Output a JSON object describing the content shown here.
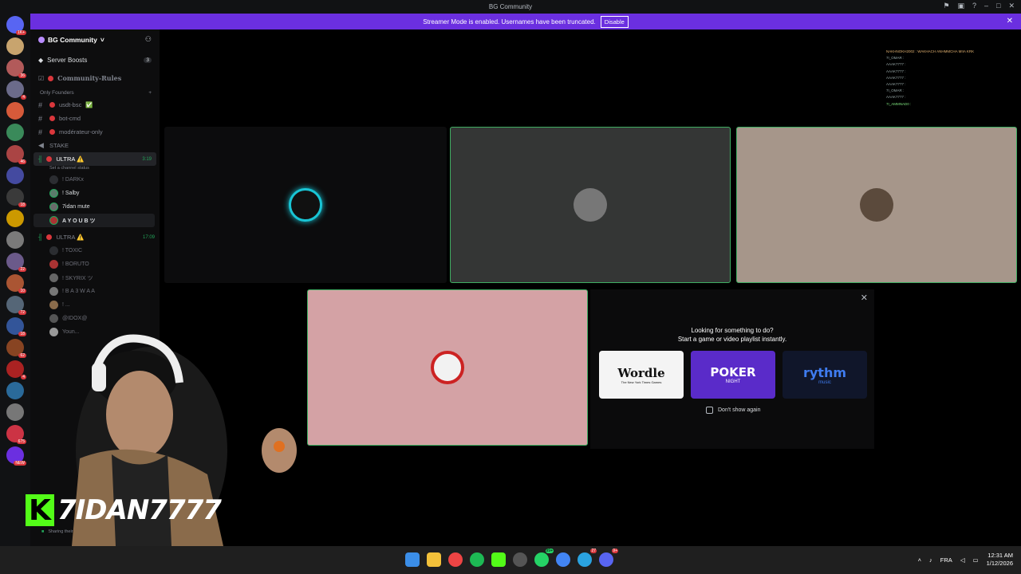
{
  "window": {
    "title": "BG Community"
  },
  "banner": {
    "text": "Streamer Mode is enabled. Usernames have been truncated.",
    "button": "Disable"
  },
  "server_badges": [
    "1K+",
    "",
    "36",
    "4",
    "",
    "",
    "46",
    "",
    "18",
    "",
    "",
    "22",
    "10",
    "72",
    "18",
    "62",
    "4",
    "",
    "",
    "675",
    "NEW"
  ],
  "sidebar": {
    "guild_name": "BG Community",
    "boost_label": "Server Boosts",
    "boost_count": "3",
    "rules_channel": "Community-Rules",
    "category_name": "Only Founders",
    "channels": [
      {
        "name": "usdt-bsc",
        "suffix": "✅"
      },
      {
        "name": "bot-cmd",
        "suffix": ""
      },
      {
        "name": "modérateur-only",
        "suffix": ""
      }
    ],
    "stake_channel": "STAKE",
    "voice1": {
      "name": "ULTRA ⚠️",
      "time": "3:19",
      "status": "Set a channel status"
    },
    "voice1_members": [
      "! DARKx",
      "! Salby",
      "7idan mute",
      "A Y O U B ツ"
    ],
    "voice2": {
      "name": "ULTRA ⚠️",
      "time": "17:09"
    },
    "voice2_members": [
      "! TOXIC",
      "! BORUTO",
      "! SKYRIX ツ",
      "! B A 3 W A A",
      "! ...",
      "@IDOX@",
      "Youn..."
    ],
    "sharing_text": "Sharing their screen"
  },
  "chat_overlay": [
    "NAKHNOKH2002 : WAKHACH ANHMMCHA MIIA KRK",
    "7I_OMAR :",
    "AAAK7777 :",
    "AAAK7777 :",
    "AAAK7777 :",
    "AAAK7777 :",
    "7I_OMAR :",
    "AAAK7777 :",
    "7I_AMMNAD0 :"
  ],
  "activity": {
    "heading_line1": "Looking for something to do?",
    "heading_line2": "Start a game or video playlist instantly.",
    "cards": [
      {
        "title": "Wordle",
        "subtitle": "The New York Times Games"
      },
      {
        "title": "POKER",
        "subtitle": "NIGHT"
      },
      {
        "title": "rythm",
        "subtitle": "music"
      }
    ],
    "dont_show": "Don't show again"
  },
  "streamer": {
    "handle": "7IDAN7777",
    "logo_letter": "K"
  },
  "taskbar": {
    "lang": "FRA",
    "time": "12:31 AM",
    "date": "1/12/2026",
    "badges": {
      "whatsapp": "99+",
      "telegram": "27",
      "discord": "9+"
    }
  },
  "colors": {
    "accent": "#5865f2",
    "banner": "#6b2fe0",
    "speaking": "#23a55a",
    "kick": "#53fc18"
  }
}
